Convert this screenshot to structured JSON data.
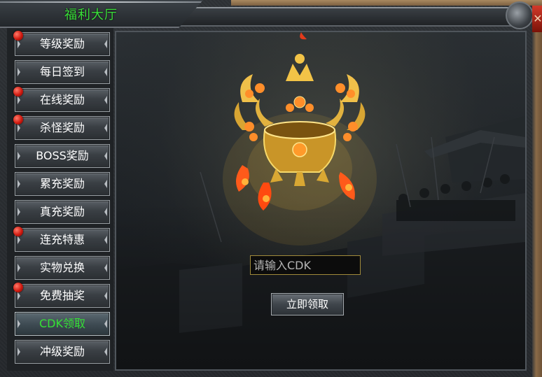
{
  "window": {
    "title": "福利大厅",
    "close_icon": "✕"
  },
  "sidebar": {
    "items": [
      {
        "label": "等级奖励",
        "has_dot": true,
        "active": false
      },
      {
        "label": "每日签到",
        "has_dot": false,
        "active": false
      },
      {
        "label": "在线奖励",
        "has_dot": true,
        "active": false
      },
      {
        "label": "杀怪奖励",
        "has_dot": true,
        "active": false
      },
      {
        "label": "BOSS奖励",
        "has_dot": false,
        "active": false
      },
      {
        "label": "累充奖励",
        "has_dot": false,
        "active": false
      },
      {
        "label": "真充奖励",
        "has_dot": false,
        "active": false
      },
      {
        "label": "连充特惠",
        "has_dot": true,
        "active": false
      },
      {
        "label": "实物兑换",
        "has_dot": false,
        "active": false
      },
      {
        "label": "免费抽奖",
        "has_dot": true,
        "active": false
      },
      {
        "label": "CDK领取",
        "has_dot": false,
        "active": true
      },
      {
        "label": "冲级奖励",
        "has_dot": false,
        "active": false
      }
    ]
  },
  "cdk": {
    "placeholder": "请输入CDK",
    "value": "",
    "claim_label": "立即领取"
  },
  "colors": {
    "title_green": "#3adf3a",
    "active_green": "#35e135",
    "dot_red": "#d01a10",
    "gold": "#e8b43a"
  }
}
